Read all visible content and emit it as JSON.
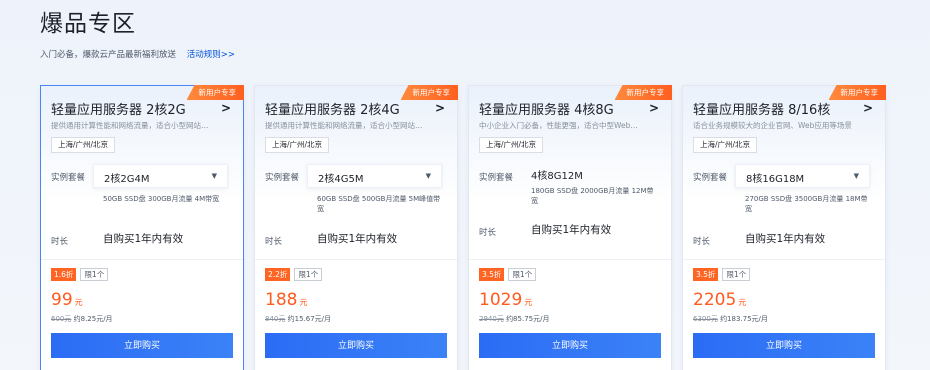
{
  "header": {
    "title": "爆品专区",
    "subtitle": "入门必备，爆款云产品最新福利放送",
    "rules_link": "活动规则>>"
  },
  "cards": [
    {
      "ribbon": "新用户专享",
      "name": "轻量应用服务器 2核2G",
      "arrow": ">",
      "desc": "提供通用计算性能和网络流量，适合小型网站…",
      "region": "上海/广州/北京",
      "spec_label": "实例套餐",
      "spec_value": "2核2G4M",
      "spec_detail": "50GB SSD盘 300GB月流量 4M带宽",
      "duration_label": "时长",
      "duration_value": "自购买1年内有效",
      "discount": "1.6折",
      "limit": "限1个",
      "price": "99",
      "price_unit": "元",
      "orig_price": "600元",
      "monthly": "约8.25元/月",
      "buy": "立即购买"
    },
    {
      "ribbon": "新用户专享",
      "name": "轻量应用服务器 2核4G",
      "arrow": ">",
      "desc": "提供通用计算性能和网络流量，适合小型网站…",
      "region": "上海/广州/北京",
      "spec_label": "实例套餐",
      "spec_value": "2核4G5M",
      "spec_detail": "60GB SSD盘 500GB月流量 5M峰值带宽",
      "duration_label": "时长",
      "duration_value": "自购买1年内有效",
      "discount": "2.2折",
      "limit": "限1个",
      "price": "188",
      "price_unit": "元",
      "orig_price": "840元",
      "monthly": "约15.67元/月",
      "buy": "立即购买"
    },
    {
      "ribbon": "新用户专享",
      "name": "轻量应用服务器 4核8G",
      "arrow": ">",
      "desc": "中小企业入门必备，性能更强，适合中型Web…",
      "region": "上海/广州/北京",
      "spec_label": "实例套餐",
      "spec_value": "4核8G12M",
      "spec_detail": "180GB SSD盘 2000GB月流量 12M带宽",
      "duration_label": "时长",
      "duration_value": "自购买1年内有效",
      "discount": "3.5折",
      "limit": "限1个",
      "price": "1029",
      "price_unit": "元",
      "orig_price": "2940元",
      "monthly": "约85.75元/月",
      "buy": "立即购买"
    },
    {
      "ribbon": "新用户专享",
      "name": "轻量应用服务器 8/16核",
      "arrow": ">",
      "desc": "适合业务规模较大的企业官网、Web应用等场景",
      "region": "上海/广州/北京",
      "spec_label": "实例套餐",
      "spec_value": "8核16G18M",
      "spec_detail": "270GB SSD盘 3500GB月流量 18M带宽",
      "duration_label": "时长",
      "duration_value": "自购买1年内有效",
      "discount": "3.5折",
      "limit": "限1个",
      "price": "2205",
      "price_unit": "元",
      "orig_price": "6300元",
      "monthly": "约183.75元/月",
      "buy": "立即购买"
    }
  ],
  "colors": {
    "accent": "#2b6cf5",
    "ribbon": "#ff6422",
    "price": "#ff5a1f"
  }
}
